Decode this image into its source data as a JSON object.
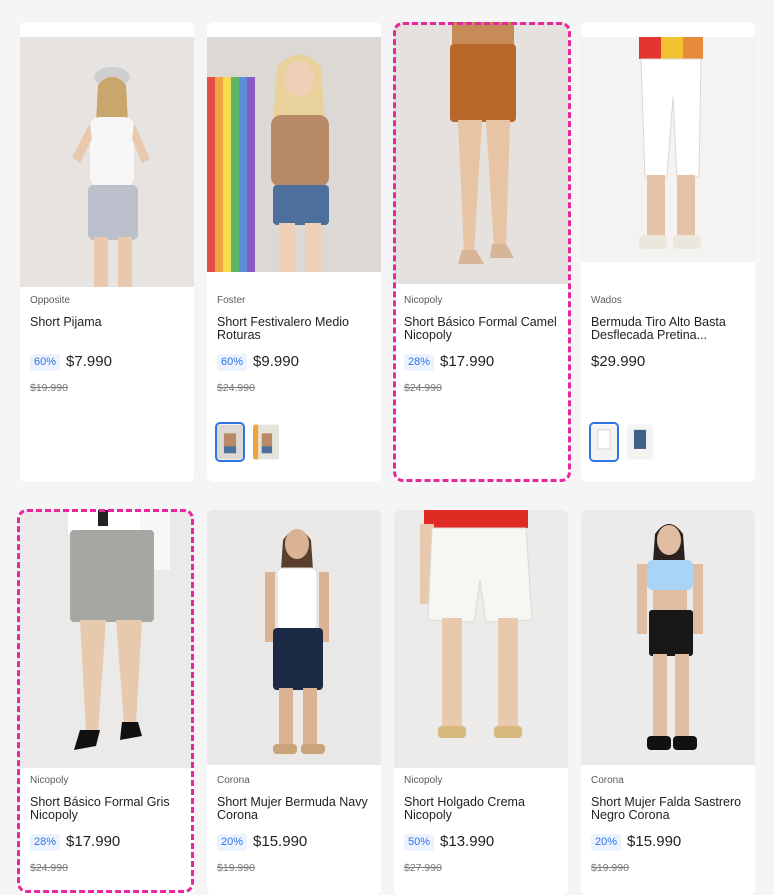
{
  "products": [
    {
      "brand": "Opposite",
      "name": "Short Pijama",
      "discount": "60%",
      "price": "$7.990",
      "old_price": "$19.990"
    },
    {
      "brand": "Foster",
      "name": "Short Festivalero Medio Roturas",
      "discount": "60%",
      "price": "$9.990",
      "old_price": "$24.990"
    },
    {
      "brand": "Nicopoly",
      "name": "Short Básico Formal Camel Nicopoly",
      "discount": "28%",
      "price": "$17.990",
      "old_price": "$24.990"
    },
    {
      "brand": "Wados",
      "name": "Bermuda Tiro Alto Basta Desflecada Pretina...",
      "discount": "",
      "price": "$29.990",
      "old_price": ""
    },
    {
      "brand": "Nicopoly",
      "name": "Short Básico Formal Gris Nicopoly",
      "discount": "28%",
      "price": "$17.990",
      "old_price": "$24.990"
    },
    {
      "brand": "Corona",
      "name": "Short Mujer Bermuda Navy Corona",
      "discount": "20%",
      "price": "$15.990",
      "old_price": "$19.990"
    },
    {
      "brand": "Nicopoly",
      "name": "Short Holgado Crema Nicopoly",
      "discount": "50%",
      "price": "$13.990",
      "old_price": "$27.990"
    },
    {
      "brand": "Corona",
      "name": "Short Mujer Falda Sastrero Negro Corona",
      "discount": "20%",
      "price": "$15.990",
      "old_price": "$19.990"
    }
  ],
  "colors": {
    "accent": "#2f74e5",
    "highlight": "#e6279d"
  }
}
